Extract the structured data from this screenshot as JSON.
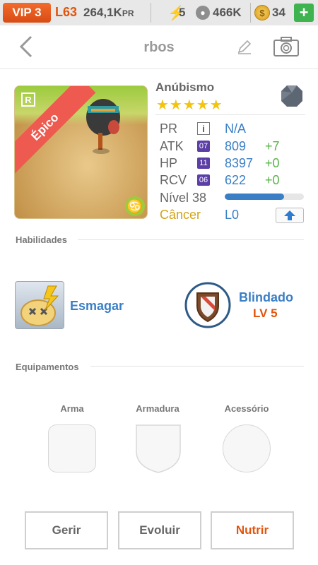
{
  "status_bar": {
    "vip": "VIP 3",
    "level": "L63",
    "power_value": "264,1K",
    "power_unit": "PR",
    "energy": "5",
    "food": "466K",
    "coins": "34",
    "add_label": "+"
  },
  "header": {
    "title": "rbos"
  },
  "card": {
    "rarity": "Épico",
    "rarity_tag": "R",
    "zodiac_symbol": "♋"
  },
  "monster": {
    "name": "Anúbismo",
    "stars": "★★★★★",
    "star_count": 5
  },
  "stats": {
    "pr": {
      "label": "PR",
      "icon": "i",
      "value": "N/A"
    },
    "atk": {
      "label": "ATK",
      "badge": "07",
      "value": "809",
      "bonus": "+7"
    },
    "hp": {
      "label": "HP",
      "badge": "11",
      "value": "8397",
      "bonus": "+0"
    },
    "rcv": {
      "label": "RCV",
      "badge": "06",
      "value": "622",
      "bonus": "+0"
    },
    "level_label": "Nível 38",
    "level_progress": 0.75,
    "sign": "Câncer",
    "lo": "L0"
  },
  "skills": {
    "section_title": "Habilidades",
    "active_name": "Esmagar",
    "passive_name": "Blindado",
    "passive_level": "LV 5"
  },
  "equipment": {
    "section_title": "Equipamentos",
    "weapon": "Arma",
    "armor": "Armadura",
    "accessory": "Acessório"
  },
  "actions": {
    "manage": "Gerir",
    "evolve": "Evoluir",
    "feed": "Nutrir"
  },
  "colors": {
    "accent_blue": "#3a7fc6",
    "accent_orange": "#e3540c",
    "bonus_green": "#5ab34a",
    "vip_orange": "#f26b2c"
  }
}
